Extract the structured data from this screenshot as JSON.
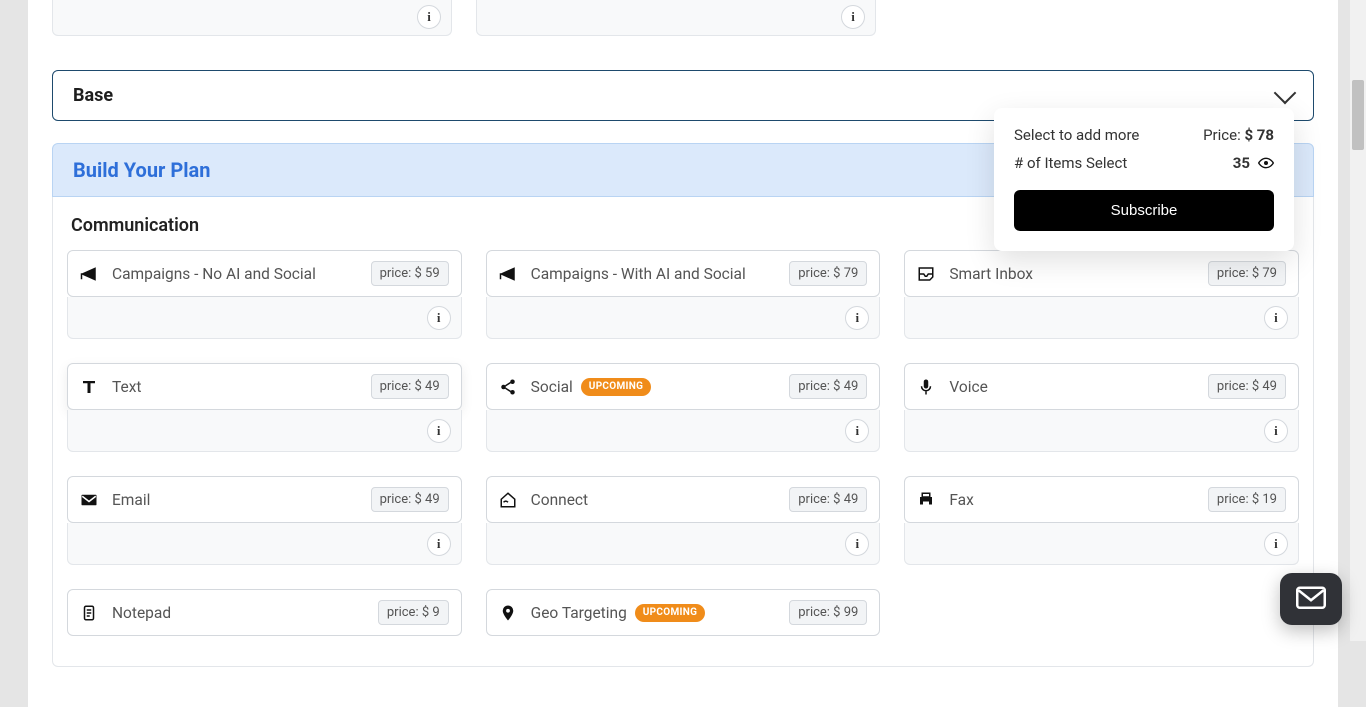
{
  "accordion": {
    "base_label": "Base"
  },
  "plan": {
    "banner_title": "Build Your Plan",
    "section_heading": "Communication",
    "price_prefix": "price: $ "
  },
  "cards": [
    {
      "id": "campaigns-noai",
      "label": "Campaigns - No AI and Social",
      "price": 59,
      "badge": null
    },
    {
      "id": "campaigns-ai",
      "label": "Campaigns - With AI and Social",
      "price": 79,
      "badge": null
    },
    {
      "id": "smart-inbox",
      "label": "Smart Inbox",
      "price": 79,
      "badge": null
    },
    {
      "id": "text",
      "label": "Text",
      "price": 49,
      "badge": null
    },
    {
      "id": "social",
      "label": "Social",
      "price": 49,
      "badge": "UPCOMING"
    },
    {
      "id": "voice",
      "label": "Voice",
      "price": 49,
      "badge": null
    },
    {
      "id": "email",
      "label": "Email",
      "price": 49,
      "badge": null
    },
    {
      "id": "connect",
      "label": "Connect",
      "price": 49,
      "badge": null
    },
    {
      "id": "fax",
      "label": "Fax",
      "price": 19,
      "badge": null
    },
    {
      "id": "notepad",
      "label": "Notepad",
      "price": 9,
      "badge": null
    },
    {
      "id": "geo-targeting",
      "label": "Geo Targeting",
      "price": 99,
      "badge": "UPCOMING"
    }
  ],
  "summary": {
    "select_more_label": "Select to add more",
    "price_label": "Price:",
    "price_value": "$ 78",
    "items_label": "# of Items Select",
    "items_value": "35",
    "subscribe_label": "Subscribe"
  },
  "info_glyph": "i"
}
